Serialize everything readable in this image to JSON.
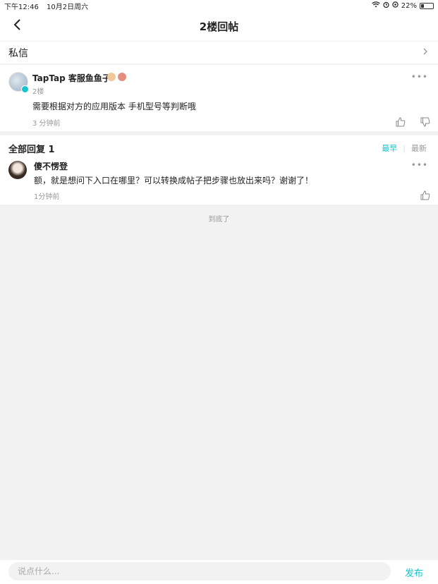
{
  "status_bar": {
    "time": "下午12:46",
    "date": "10月2日周六",
    "battery_text": "22%",
    "battery_level": 0.22
  },
  "nav": {
    "title": "2楼回帖"
  },
  "private_message": {
    "label": "私信"
  },
  "main_post": {
    "author": "TapTap 客服鱼鱼子",
    "floor": "2楼",
    "content": "需要根据对方的应用版本 手机型号等判断哦",
    "time": "3 分钟前"
  },
  "replies": {
    "title": "全部回复 1",
    "sort_active": "最早",
    "sort_separator": "|",
    "sort_inactive": "最新",
    "items": [
      {
        "author": "傻不愣登",
        "content": "额，就是想问下入口在哪里？可以转换成帖子把步骤也放出来吗？谢谢了！",
        "time": "1分钟前"
      }
    ]
  },
  "end_text": "到底了",
  "bottom_bar": {
    "placeholder": "说点什么...",
    "publish_label": "发布"
  },
  "colors": {
    "accent": "#15c5ce",
    "background": "#f2f2f2"
  },
  "icons": {
    "back": "chevron-left-icon",
    "chevron": "chevron-right-icon",
    "more": "more-horizontal-icon",
    "like": "thumbs-up-icon",
    "dislike": "thumbs-down-icon"
  }
}
